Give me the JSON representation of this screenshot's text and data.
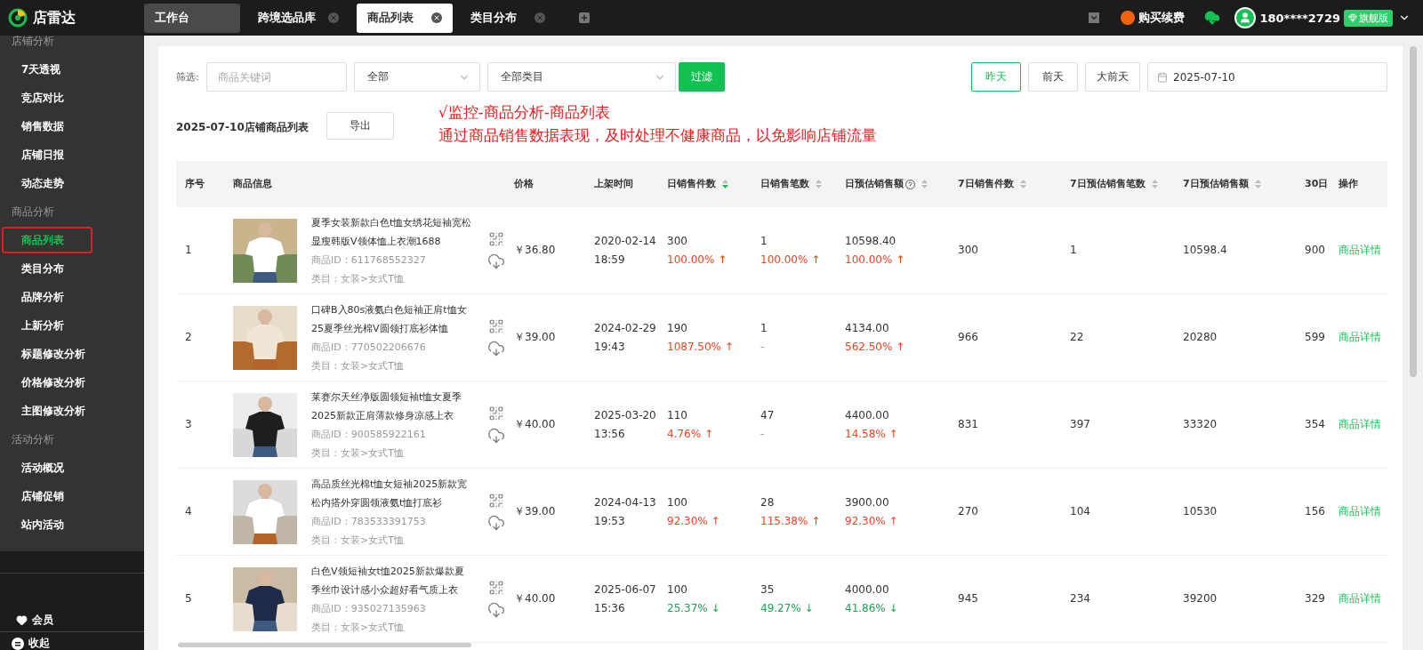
{
  "topbar": {
    "logo": "店雷达",
    "tabs": [
      {
        "label": "工作台",
        "kind": "home",
        "selected": false
      },
      {
        "label": "跨境选品库",
        "kind": "closable",
        "selected": false
      },
      {
        "label": "商品列表",
        "kind": "closable",
        "selected": true
      },
      {
        "label": "类目分布",
        "kind": "closable",
        "selected": false
      }
    ],
    "renew": "购买续费",
    "account": "180****2729",
    "plan": "旗舰版"
  },
  "sidebar": {
    "groups": [
      {
        "title": "店铺分析",
        "items": [
          {
            "label": "7天透视",
            "selected": false,
            "outlined": false
          },
          {
            "label": "竞店对比",
            "selected": false,
            "outlined": false
          },
          {
            "label": "销售数据",
            "selected": false,
            "outlined": false
          },
          {
            "label": "店铺日报",
            "selected": false,
            "outlined": false
          },
          {
            "label": "动态走势",
            "selected": false,
            "outlined": false
          }
        ]
      },
      {
        "title": "商品分析",
        "items": [
          {
            "label": "商品列表",
            "selected": true,
            "outlined": true
          },
          {
            "label": "类目分布",
            "selected": false,
            "outlined": false
          },
          {
            "label": "品牌分析",
            "selected": false,
            "outlined": false
          },
          {
            "label": "上新分析",
            "selected": false,
            "outlined": false
          },
          {
            "label": "标题修改分析",
            "selected": false,
            "outlined": false
          },
          {
            "label": "价格修改分析",
            "selected": false,
            "outlined": false
          },
          {
            "label": "主图修改分析",
            "selected": false,
            "outlined": false
          }
        ]
      },
      {
        "title": "活动分析",
        "items": [
          {
            "label": "活动概况",
            "selected": false,
            "outlined": false
          },
          {
            "label": "店铺促销",
            "selected": false,
            "outlined": false
          },
          {
            "label": "站内活动",
            "selected": false,
            "outlined": false
          }
        ]
      }
    ],
    "member": "会员",
    "collapse": "收起"
  },
  "filter": {
    "label": "筛选:",
    "keyword": {
      "placeholder": "商品关键词"
    },
    "status": "全部",
    "category": "全部类目",
    "submit": "过滤",
    "days": [
      {
        "label": "昨天",
        "selected": true
      },
      {
        "label": "前天",
        "selected": false
      },
      {
        "label": "大前天",
        "selected": false
      }
    ],
    "date": "2025-07-10"
  },
  "list": {
    "title": "2025-07-10店铺商品列表",
    "export": "导出"
  },
  "annotation": [
    "√监控-商品分析-商品列表",
    "通过商品销售数据表现，及时处理不健康商品，以免影响店铺流量"
  ],
  "table": {
    "columns": [
      {
        "label": "序号"
      },
      {
        "label": "商品信息"
      },
      {
        "label": "价格"
      },
      {
        "label": "上架时间"
      },
      {
        "label": "日销售件数",
        "sorted": true
      },
      {
        "label": "日销售笔数",
        "sorted": false
      },
      {
        "label": "日预估销售额",
        "sorted": false,
        "help": true
      },
      {
        "label": "7日销售件数",
        "sorted": false
      },
      {
        "label": "7日预估销售笔数",
        "sorted": false
      },
      {
        "label": "7日预估销售额",
        "sorted": false
      },
      {
        "label": "30日"
      },
      {
        "label": "操作"
      }
    ],
    "rows": [
      {
        "no": "1",
        "title": "夏季女装新款白色t恤女绣花短袖宽松显瘦韩版V领体恤上衣潮1688",
        "product_id": "商品ID：611768552327",
        "category": "类目：女装>女式T恤",
        "price": "￥36.80",
        "listed_date": "2020-02-14",
        "listed_time": "18:59",
        "daily_units": "300",
        "daily_units_change": {
          "text": "100.00% ↑",
          "rising": true
        },
        "daily_orders": "1",
        "daily_orders_change": {
          "text": "100.00% ↑",
          "rising": true
        },
        "daily_revenue": "10598.40",
        "daily_revenue_change": {
          "text": "100.00% ↑",
          "rising": true
        },
        "units_7d": "300",
        "orders_7d": "1",
        "revenue_7d": "10598.4",
        "column_30d": "900",
        "action": "商品详情"
      },
      {
        "no": "2",
        "title": "口碑B入80s液氨白色短袖正肩t恤女 25夏季丝光棉V圆领打底衫体恤",
        "product_id": "商品ID：770502206676",
        "category": "类目：女装>女式T恤",
        "price": "￥39.00",
        "listed_date": "2024-02-29",
        "listed_time": "19:43",
        "daily_units": "190",
        "daily_units_change": {
          "text": "1087.50% ↑",
          "rising": true
        },
        "daily_orders": "1",
        "daily_orders_change": {
          "text": "-"
        },
        "daily_revenue": "4134.00",
        "daily_revenue_change": {
          "text": "562.50% ↑",
          "rising": true
        },
        "units_7d": "966",
        "orders_7d": "22",
        "revenue_7d": "20280",
        "column_30d": "599",
        "action": "商品详情"
      },
      {
        "no": "3",
        "title": "莱赛尔天丝净版圆领短袖t恤女夏季2025新款正肩薄款修身凉感上衣",
        "product_id": "商品ID：900585922161",
        "category": "类目：女装>女式T恤",
        "price": "￥40.00",
        "listed_date": "2025-03-20",
        "listed_time": "13:56",
        "daily_units": "110",
        "daily_units_change": {
          "text": "4.76% ↑",
          "rising": true
        },
        "daily_orders": "47",
        "daily_orders_change": {
          "text": "-"
        },
        "daily_revenue": "4400.00",
        "daily_revenue_change": {
          "text": "14.58% ↑",
          "rising": true
        },
        "units_7d": "831",
        "orders_7d": "397",
        "revenue_7d": "33320",
        "column_30d": "354",
        "action": "商品详情"
      },
      {
        "no": "4",
        "title": "高品质丝光棉t恤女短袖2025新款宽松内搭外穿圆领液氨t恤打底衫",
        "product_id": "商品ID：783533391753",
        "category": "类目：女装>女式T恤",
        "price": "￥39.00",
        "listed_date": "2024-04-13",
        "listed_time": "19:53",
        "daily_units": "100",
        "daily_units_change": {
          "text": "92.30% ↑",
          "rising": true
        },
        "daily_orders": "28",
        "daily_orders_change": {
          "text": "115.38% ↑",
          "rising": true
        },
        "daily_revenue": "3900.00",
        "daily_revenue_change": {
          "text": "92.30% ↑",
          "rising": true
        },
        "units_7d": "270",
        "orders_7d": "104",
        "revenue_7d": "10530",
        "column_30d": "156",
        "action": "商品详情"
      },
      {
        "no": "5",
        "title": "白色V领短袖女t恤2025新款爆款夏季丝巾设计感小众超好看气质上衣",
        "product_id": "商品ID：935027135963",
        "category": "类目：女装>女式T恤",
        "price": "￥40.00",
        "listed_date": "2025-06-07",
        "listed_time": "15:36",
        "daily_units": "100",
        "daily_units_change": {
          "text": "25.37% ↓",
          "rising": false
        },
        "daily_orders": "35",
        "daily_orders_change": {
          "text": "49.27% ↓",
          "rising": false
        },
        "daily_revenue": "4000.00",
        "daily_revenue_change": {
          "text": "41.86% ↓",
          "rising": false
        },
        "units_7d": "945",
        "orders_7d": "234",
        "revenue_7d": "39200",
        "column_30d": "329",
        "action": "商品详情"
      }
    ]
  }
}
